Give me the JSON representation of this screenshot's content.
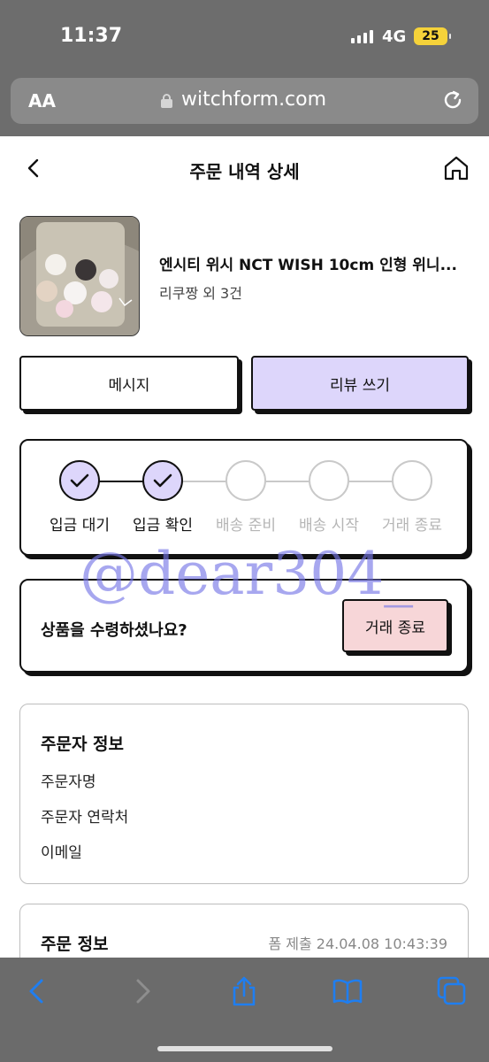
{
  "status_bar": {
    "time": "11:37",
    "network": "4G",
    "battery": "25"
  },
  "browser": {
    "text_size_label": "AA",
    "url": "witchform.com"
  },
  "header": {
    "title": "주문 내역 상세"
  },
  "product": {
    "name": "엔시티 위시 NCT WISH 10cm 인형 위니...",
    "sub": "리쿠짱 외 3건"
  },
  "actions": {
    "message": "메시지",
    "review": "리뷰 쓰기"
  },
  "steps": [
    {
      "label": "입금 대기",
      "state": "done"
    },
    {
      "label": "입금 확인",
      "state": "done"
    },
    {
      "label": "배송 준비",
      "state": "todo"
    },
    {
      "label": "배송 시작",
      "state": "todo"
    },
    {
      "label": "거래 종료",
      "state": "todo"
    }
  ],
  "watermark": "@dear304_",
  "receive": {
    "question": "상품을 수령하셨나요?",
    "button": "거래 종료"
  },
  "orderer": {
    "title": "주문자 정보",
    "rows": [
      "주문자명",
      "주문자 연락처",
      "이메일"
    ]
  },
  "order": {
    "title": "주문 정보",
    "meta": "폼 제출 24.04.08 10:43:39"
  },
  "colors": {
    "accent_lavender": "#ddd6fb",
    "end_pink": "#f7d6d8",
    "ios_blue": "#0a84ff"
  }
}
